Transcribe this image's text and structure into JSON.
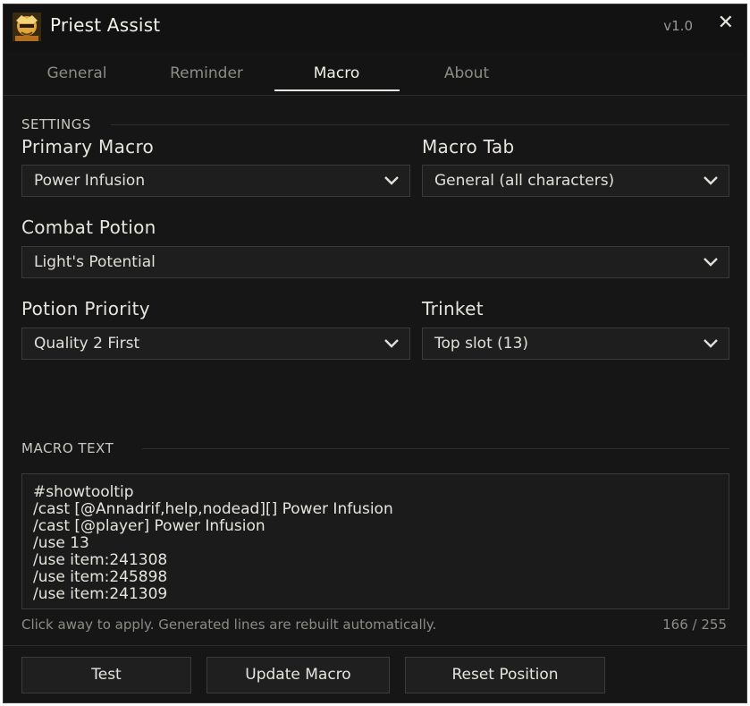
{
  "titlebar": {
    "title": "Priest Assist",
    "version": "v1.0",
    "close_label": "✕"
  },
  "tabs": [
    {
      "label": "General",
      "active": false
    },
    {
      "label": "Reminder",
      "active": false
    },
    {
      "label": "Macro",
      "active": true
    },
    {
      "label": "About",
      "active": false
    }
  ],
  "settings": {
    "section_label": "SETTINGS",
    "primary_macro": {
      "label": "Primary Macro",
      "value": "Power Infusion"
    },
    "macro_tab": {
      "label": "Macro Tab",
      "value": "General (all characters)"
    },
    "combat_potion": {
      "label": "Combat Potion",
      "value": "Light's Potential"
    },
    "potion_priority": {
      "label": "Potion Priority",
      "value": "Quality 2 First"
    },
    "trinket": {
      "label": "Trinket",
      "value": "Top slot (13)"
    }
  },
  "macro_text": {
    "section_label": "MACRO TEXT",
    "lines": [
      "#showtooltip",
      "/cast [@Annadrif,help,nodead][] Power Infusion",
      "/cast [@player] Power Infusion",
      "/use 13",
      "/use item:241308",
      "/use item:245898",
      "/use item:241309"
    ],
    "hint": "Click away to apply. Generated lines are rebuilt automatically.",
    "counter": "166 / 255"
  },
  "buttons": {
    "test": "Test",
    "update_macro": "Update Macro",
    "reset_position": "Reset Position"
  },
  "colors": {
    "background": "#161616",
    "text": "#e6e4de",
    "muted": "#8d8b86",
    "border": "#3a3a3a"
  }
}
